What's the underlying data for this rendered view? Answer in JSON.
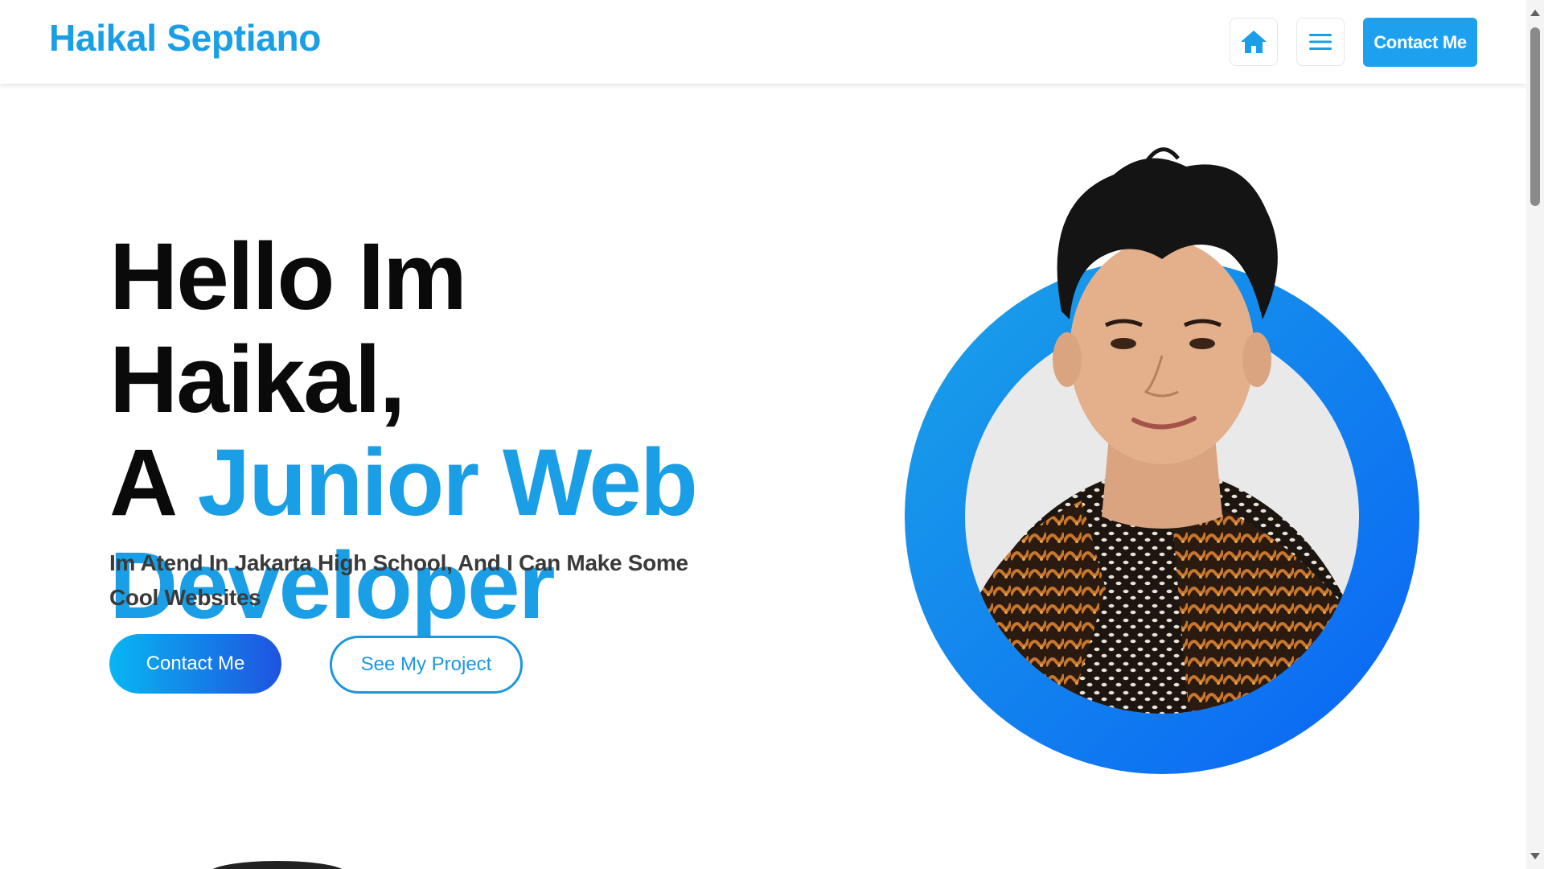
{
  "header": {
    "brand": "Haikal Septiano",
    "contact_label": "Contact Me"
  },
  "icons": {
    "home": "home-icon",
    "menu": "hamburger-menu-icon"
  },
  "hero": {
    "title_line1": "Hello Im Haikal,",
    "title_prefix": "A ",
    "title_accent": "Junior Web Developer",
    "subtitle": "Im Atend In Jakarta High School, And I Can Make Some Cool Websites",
    "primary_button": "Contact Me",
    "secondary_button": "See My Project"
  },
  "colors": {
    "brand": "#1a9ee6",
    "nav_button": "#1da1ee",
    "gradient_start": "#07b6f2",
    "gradient_end": "#1f53e0",
    "ring_start": "#1aa3e8",
    "ring_end": "#0a63f5"
  }
}
